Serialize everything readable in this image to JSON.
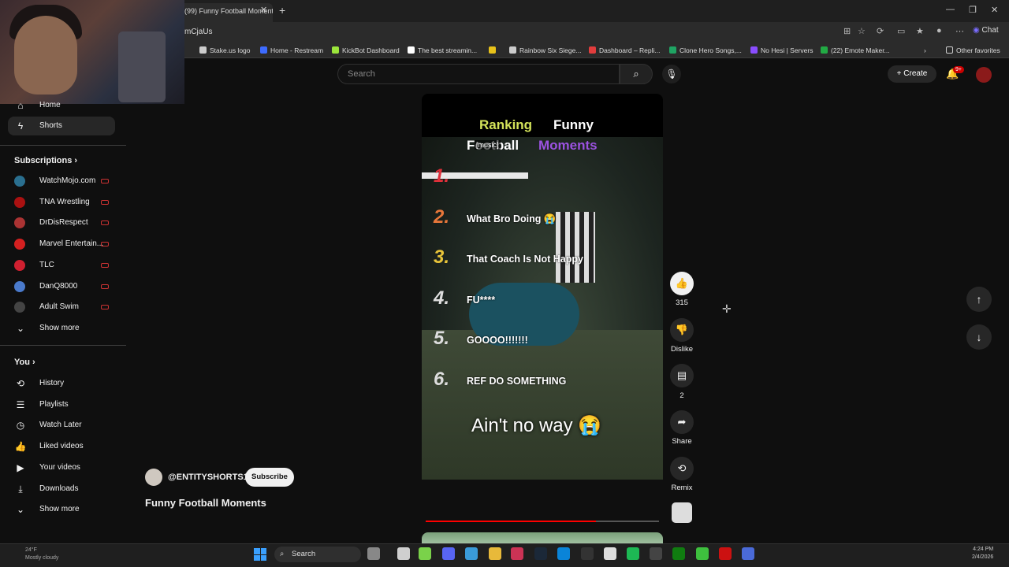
{
  "browser": {
    "tab_title": "(99) Funny Football Moments",
    "url_fragment": "mCjaUs",
    "chat_label": "Chat",
    "bookmarks": [
      {
        "label": "Stake.us logo",
        "color": "#cccccc"
      },
      {
        "label": "Home - Restream",
        "color": "#3d6bff"
      },
      {
        "label": "KickBot Dashboard",
        "color": "#9be53b"
      },
      {
        "label": "The best streamin...",
        "color": "#ffffff"
      },
      {
        "label": "",
        "color": "#e8c21a"
      },
      {
        "label": "Rainbow Six Siege...",
        "color": "#cccccc"
      },
      {
        "label": "Dashboard – Repli...",
        "color": "#e23d3d"
      },
      {
        "label": "Clone Hero Songs,...",
        "color": "#1fa463"
      },
      {
        "label": "No Hesi | Servers",
        "color": "#8a4dff"
      },
      {
        "label": "(22) Emote Maker...",
        "color": "#22aa44"
      }
    ],
    "other_favorites": "Other favorites"
  },
  "header": {
    "search_placeholder": "Search",
    "create_label": "Create",
    "notification_count": "9+"
  },
  "sidebar": {
    "home": "Home",
    "shorts": "Shorts",
    "subscriptions_title": "Subscriptions",
    "subscriptions": [
      {
        "name": "WatchMojo.com",
        "color": "#2a6f8f"
      },
      {
        "name": "TNA Wrestling",
        "color": "#aa1111"
      },
      {
        "name": "DrDisRespect",
        "color": "#a33"
      },
      {
        "name": "Marvel Entertain...",
        "color": "#d42020"
      },
      {
        "name": "TLC",
        "color": "#d02030"
      },
      {
        "name": "DanQ8000",
        "color": "#4a7acc"
      },
      {
        "name": "Adult Swim",
        "color": "#444444"
      }
    ],
    "show_more": "Show more",
    "you_title": "You",
    "you_items": [
      "History",
      "Playlists",
      "Watch Later",
      "Liked videos",
      "Your videos",
      "Downloads"
    ],
    "show_more_2": "Show more"
  },
  "video": {
    "title_line1_a": "Ranking",
    "title_line1_b": "Funny",
    "title_line2_a": "Football",
    "title_line2_b": "Moments",
    "caption_tag": "[music]",
    "ranks": [
      {
        "num": "1.",
        "label": "",
        "color": "#e0303a"
      },
      {
        "num": "2.",
        "label": "What Bro Doing 😭",
        "color": "#e8773a"
      },
      {
        "num": "3.",
        "label": "That Coach Is Not Happy",
        "color": "#e8c43a"
      },
      {
        "num": "4.",
        "label": "FU****",
        "color": "#dddddd"
      },
      {
        "num": "5.",
        "label": "GOOOO!!!!!!!",
        "color": "#dddddd"
      },
      {
        "num": "6.",
        "label": "REF DO SOMETHING",
        "color": "#dddddd"
      }
    ],
    "subtitle": "Ain't no way 😭",
    "progress": 0.73,
    "channel": "@ENTITYSHORTS1",
    "subscribe_label": "Subscribe",
    "video_title": "Funny Football Moments"
  },
  "actions": {
    "like_count": "315",
    "dislike_label": "Dislike",
    "comment_count": "2",
    "share_label": "Share",
    "remix_label": "Remix"
  },
  "taskbar": {
    "weather_temp": "24°F",
    "weather_desc": "Mostly cloudy",
    "search_label": "Search",
    "time": "4:24 PM",
    "date": "2/4/2026"
  }
}
